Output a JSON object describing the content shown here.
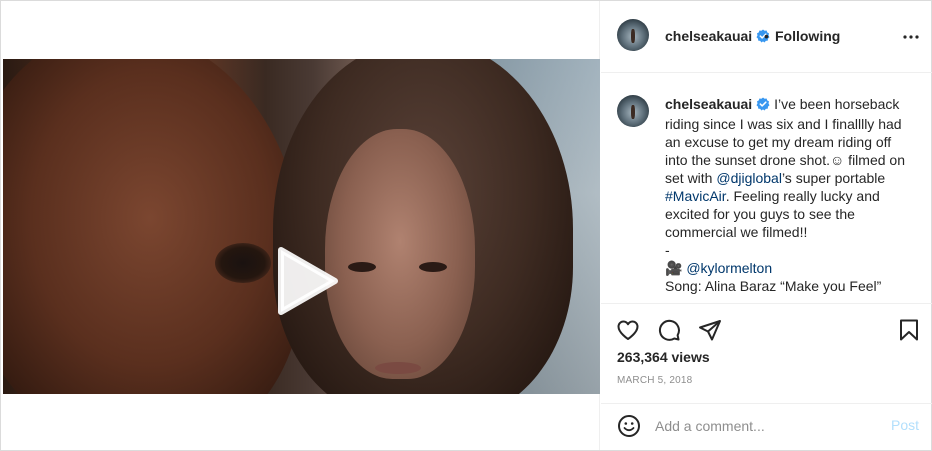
{
  "header": {
    "username": "chelseakauai",
    "separator": "•",
    "follow_label": "Following"
  },
  "caption": {
    "username": "chelseakauai",
    "text_1": "I’ve been horseback riding since I was six and I finalllly had an excuse to get my dream riding off into the sunset drone shot.",
    "emoji": "☺",
    "text_2": " filmed on set with ",
    "mention_1": "@djiglobal",
    "text_3": "’s super portable ",
    "hashtag": "#MavicAir",
    "text_4": ". Feeling really lucky and excited for you guys to see the commercial we filmed!!",
    "dash": "-",
    "camera_emoji": "🎥",
    "mention_2": "@kylormelton",
    "song": "Song: Alina Baraz “Make you Feel”"
  },
  "stats": {
    "views": "263,364 views",
    "date": "MARCH 5, 2018"
  },
  "comment_bar": {
    "placeholder": "Add a comment...",
    "post_label": "Post"
  },
  "icons": {
    "verified": "verified-badge-icon",
    "more": "more-options-icon",
    "play": "play-icon",
    "mute": "sound-off-icon",
    "like": "heart-icon",
    "comment": "comment-bubble-icon",
    "share": "paper-plane-icon",
    "save": "bookmark-icon",
    "emoji": "smiley-icon"
  },
  "colors": {
    "verified": "#3897f0",
    "link": "#00376b",
    "post_disabled": "#b2dffc",
    "muted_text": "#8e8e8e"
  }
}
